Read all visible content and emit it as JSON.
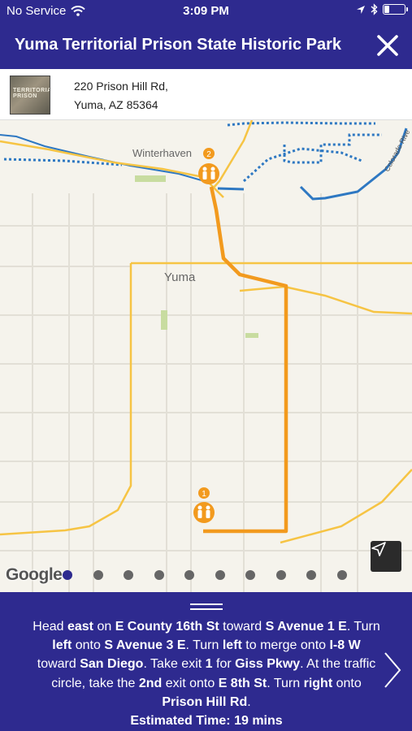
{
  "status_bar": {
    "carrier": "No Service",
    "time": "3:09 PM"
  },
  "header": {
    "title": "Yuma Territorial Prison State Historic Park"
  },
  "address": {
    "line1": "220 Prison Hill Rd,",
    "line2": "Yuma, AZ 85364",
    "thumbnail_text": "TERRITORIAL PRISON"
  },
  "map": {
    "labels": {
      "winterhaven": "Winterhaven",
      "yuma": "Yuma",
      "river": "Colorado Rive"
    },
    "markers": [
      {
        "number": "1"
      },
      {
        "number": "2"
      }
    ],
    "attribution": "Google",
    "step_count": 10,
    "active_step": 0
  },
  "directions": {
    "segments": [
      {
        "text": "Head ",
        "bold": false
      },
      {
        "text": "east",
        "bold": true
      },
      {
        "text": " on ",
        "bold": false
      },
      {
        "text": "E County 16th St",
        "bold": true
      },
      {
        "text": " toward ",
        "bold": false
      },
      {
        "text": "S Avenue 1 E",
        "bold": true
      },
      {
        "text": ". Turn ",
        "bold": false
      },
      {
        "text": "left",
        "bold": true
      },
      {
        "text": " onto ",
        "bold": false
      },
      {
        "text": "S Avenue 3 E",
        "bold": true
      },
      {
        "text": ". Turn ",
        "bold": false
      },
      {
        "text": "left",
        "bold": true
      },
      {
        "text": " to merge onto ",
        "bold": false
      },
      {
        "text": "I-8 W",
        "bold": true
      },
      {
        "text": " toward ",
        "bold": false
      },
      {
        "text": "San Diego",
        "bold": true
      },
      {
        "text": ". Take exit ",
        "bold": false
      },
      {
        "text": "1",
        "bold": true
      },
      {
        "text": " for ",
        "bold": false
      },
      {
        "text": "Giss Pkwy",
        "bold": true
      },
      {
        "text": ". At the traffic circle, take the ",
        "bold": false
      },
      {
        "text": "2nd",
        "bold": true
      },
      {
        "text": " exit onto ",
        "bold": false
      },
      {
        "text": "E 8th St",
        "bold": true
      },
      {
        "text": ". Turn ",
        "bold": false
      },
      {
        "text": "right",
        "bold": true
      },
      {
        "text": " onto ",
        "bold": false
      },
      {
        "text": "Prison Hill Rd",
        "bold": true
      },
      {
        "text": ".",
        "bold": false
      }
    ],
    "estimated_time": "Estimated Time: 19 mins"
  },
  "colors": {
    "primary": "#2e2a8f",
    "route": "#f29a1e",
    "highway": "#f6c444",
    "water": "#2e78c2"
  }
}
